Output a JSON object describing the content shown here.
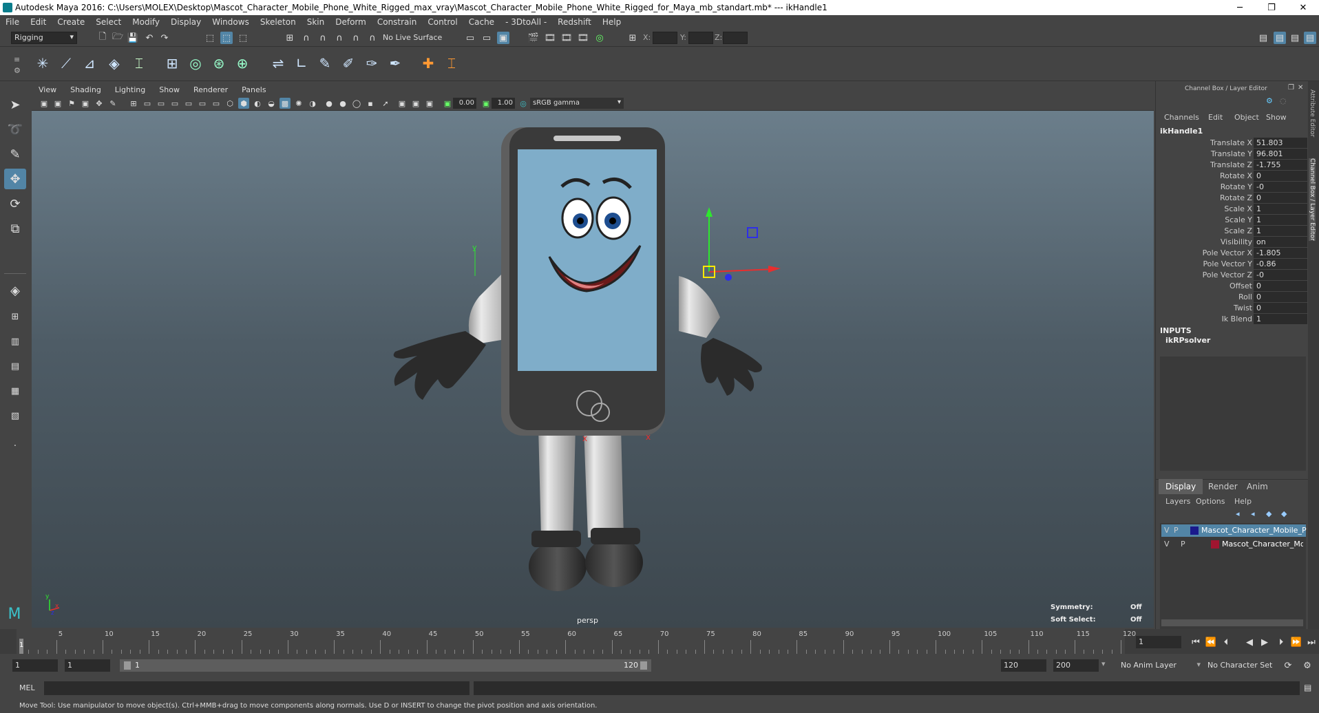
{
  "window": {
    "title": "Autodesk Maya 2016: C:\\Users\\MOLEX\\Desktop\\Mascot_Character_Mobile_Phone_White_Rigged_max_vray\\Mascot_Character_Mobile_Phone_White_Rigged_for_Maya_mb_standart.mb*  ---  ikHandle1",
    "minimize": "─",
    "restore": "❐",
    "close": "✕"
  },
  "menu": [
    "File",
    "Edit",
    "Create",
    "Select",
    "Modify",
    "Display",
    "Windows",
    "Skeleton",
    "Skin",
    "Deform",
    "Constrain",
    "Control",
    "Cache",
    "- 3DtoAll -",
    "Redshift",
    "Help"
  ],
  "status": {
    "mode": "Rigging",
    "live_surface": "No Live Surface",
    "x_label": "X:",
    "y_label": "Y:",
    "z_label": "Z:"
  },
  "panel_menu": [
    "View",
    "Shading",
    "Lighting",
    "Show",
    "Renderer",
    "Panels"
  ],
  "panel_toolbar": {
    "near": "0.00",
    "far": "1.00",
    "colorspace": "sRGB gamma"
  },
  "viewport": {
    "camera": "persp",
    "symmetry_label": "Symmetry:",
    "symmetry_value": "Off",
    "soft_select_label": "Soft Select:",
    "soft_select_value": "Off"
  },
  "channel_box": {
    "title": "Channel Box / Layer Editor",
    "menus": [
      "Channels",
      "Edit",
      "Object",
      "Show"
    ],
    "node": "ikHandle1",
    "channels": [
      {
        "label": "Translate X",
        "value": "51.803"
      },
      {
        "label": "Translate Y",
        "value": "96.801"
      },
      {
        "label": "Translate Z",
        "value": "-1.755"
      },
      {
        "label": "Rotate X",
        "value": "0"
      },
      {
        "label": "Rotate Y",
        "value": "-0"
      },
      {
        "label": "Rotate Z",
        "value": "0"
      },
      {
        "label": "Scale X",
        "value": "1"
      },
      {
        "label": "Scale Y",
        "value": "1"
      },
      {
        "label": "Scale Z",
        "value": "1"
      },
      {
        "label": "Visibility",
        "value": "on"
      },
      {
        "label": "Pole Vector X",
        "value": "-1.805"
      },
      {
        "label": "Pole Vector Y",
        "value": "-0.86"
      },
      {
        "label": "Pole Vector Z",
        "value": "-0"
      },
      {
        "label": "Offset",
        "value": "0"
      },
      {
        "label": "Roll",
        "value": "0"
      },
      {
        "label": "Twist",
        "value": "0"
      },
      {
        "label": "Ik Blend",
        "value": "1"
      }
    ],
    "inputs_header": "INPUTS",
    "input_node": "ikRPsolver"
  },
  "layer_editor": {
    "tabs": [
      "Display",
      "Render",
      "Anim"
    ],
    "menus": [
      "Layers",
      "Options",
      "Help"
    ],
    "layers": [
      {
        "v": "V",
        "p": "P",
        "name": "Mascot_Character_Mobile_P",
        "color": "#1a1a8c"
      },
      {
        "v": "V",
        "p": "P",
        "name": "Mascot_Character_Mo",
        "color": "#a01530"
      }
    ]
  },
  "side_tabs": [
    "Attribute Editor",
    "Channel Box / Layer Editor"
  ],
  "timeline": {
    "ticks": [
      "5",
      "10",
      "15",
      "20",
      "25",
      "30",
      "35",
      "40",
      "45",
      "50",
      "55",
      "60",
      "65",
      "70",
      "75",
      "80",
      "85",
      "90",
      "95",
      "100",
      "105",
      "110",
      "115",
      "120"
    ],
    "start_label": "1",
    "current_frame": "1"
  },
  "range": {
    "start": "1",
    "playback_start": "1",
    "slider_start": "1",
    "slider_end": "120",
    "playback_end": "120",
    "end": "200",
    "anim_layer": "No Anim Layer",
    "character_set": "No Character Set"
  },
  "mel": {
    "label": "MEL"
  },
  "help_line": "Move Tool: Use manipulator to move object(s). Ctrl+MMB+drag to move components along normals. Use D or INSERT to change the pivot position and axis orientation.",
  "colors": {
    "accent": "#5285a6",
    "bg": "#444444",
    "screen": "#7fadc9"
  }
}
